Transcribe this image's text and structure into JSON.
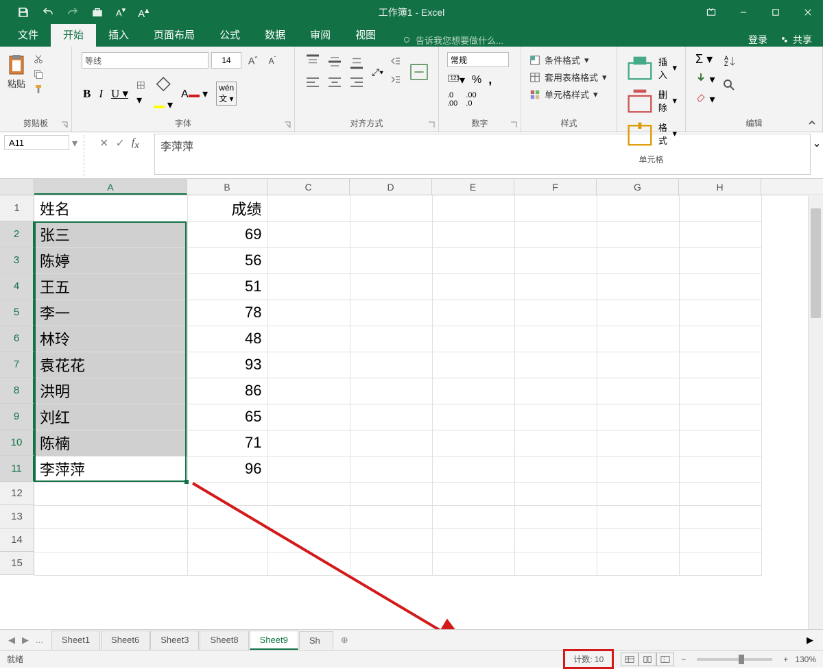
{
  "title": "工作簿1 - Excel",
  "ribbon_tabs": [
    "文件",
    "开始",
    "插入",
    "页面布局",
    "公式",
    "数据",
    "审阅",
    "视图"
  ],
  "tell_me": "告诉我您想要做什么...",
  "signin": "登录",
  "share": "共享",
  "clipboard": {
    "paste": "粘贴",
    "label": "剪贴板"
  },
  "font": {
    "name": "等线",
    "size": "14",
    "label": "字体"
  },
  "align_label": "对齐方式",
  "number": {
    "format": "常规",
    "label": "数字"
  },
  "styles": {
    "cond": "条件格式",
    "table": "套用表格格式",
    "cell": "单元格样式",
    "label": "样式"
  },
  "cells": {
    "insert": "插入",
    "delete": "删除",
    "format": "格式",
    "label": "单元格"
  },
  "editing_label": "编辑",
  "name_box": "A11",
  "formula": "李萍萍",
  "cols": [
    "A",
    "B",
    "C",
    "D",
    "E",
    "F",
    "G",
    "H"
  ],
  "rows": [
    {
      "n": "1",
      "a": "姓名",
      "b": "成绩",
      "sel": false
    },
    {
      "n": "2",
      "a": "张三",
      "b": "69",
      "sel": true
    },
    {
      "n": "3",
      "a": "陈婷",
      "b": "56",
      "sel": true
    },
    {
      "n": "4",
      "a": "王五",
      "b": "51",
      "sel": true
    },
    {
      "n": "5",
      "a": "李一",
      "b": "78",
      "sel": true
    },
    {
      "n": "6",
      "a": "林玲",
      "b": "48",
      "sel": true
    },
    {
      "n": "7",
      "a": "袁花花",
      "b": "93",
      "sel": true
    },
    {
      "n": "8",
      "a": "洪明",
      "b": "86",
      "sel": true
    },
    {
      "n": "9",
      "a": "刘红",
      "b": "65",
      "sel": true
    },
    {
      "n": "10",
      "a": "陈楠",
      "b": "71",
      "sel": true
    },
    {
      "n": "11",
      "a": "李萍萍",
      "b": "96",
      "sel": true,
      "active": true
    },
    {
      "n": "12",
      "a": "",
      "b": "",
      "sel": false,
      "sm": true
    },
    {
      "n": "13",
      "a": "",
      "b": "",
      "sel": false,
      "sm": true
    },
    {
      "n": "14",
      "a": "",
      "b": "",
      "sel": false,
      "sm": true
    },
    {
      "n": "15",
      "a": "",
      "b": "",
      "sel": false,
      "sm": true
    }
  ],
  "sheets": [
    "Sheet1",
    "Sheet6",
    "Sheet3",
    "Sheet8",
    "Sheet9"
  ],
  "active_sheet": "Sheet9",
  "status_left": "就绪",
  "status_count": "计数: 10",
  "zoom": "130%"
}
